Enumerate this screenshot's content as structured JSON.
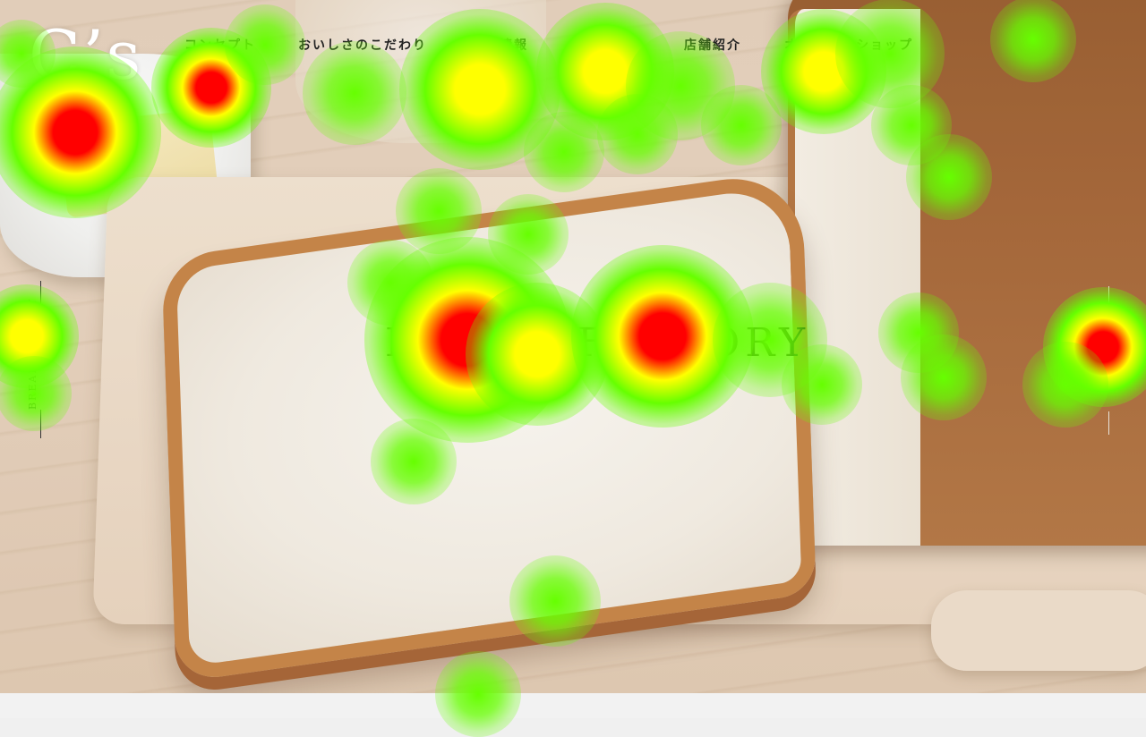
{
  "logo": {
    "main": "C’s",
    "sub": "e"
  },
  "nav": {
    "items": [
      {
        "label": "コンセプト"
      },
      {
        "label": "おいしさのこだわり"
      },
      {
        "label": "商品情報"
      },
      {
        "label": "食パン配送"
      },
      {
        "label": "店舗紹介"
      },
      {
        "label": "オンラインショップ"
      }
    ]
  },
  "hero": {
    "title": "BREAD FACTORY"
  },
  "side_left": {
    "label": "BREAD FACTORY"
  },
  "side_right": {
    "icon": "instagram-icon"
  },
  "heatmap": {
    "colors": {
      "hot": "#ff0000",
      "warm": "#ffff00",
      "cool": "#66ff00"
    }
  }
}
